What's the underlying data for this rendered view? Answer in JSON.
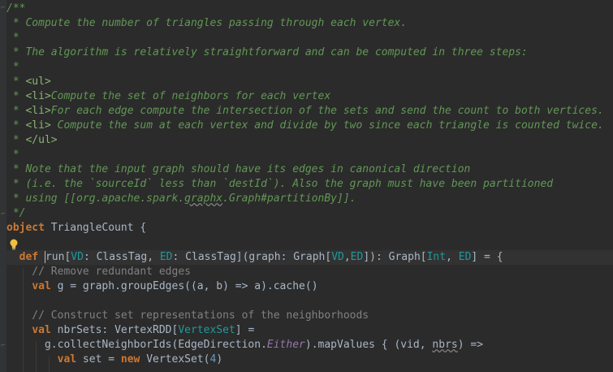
{
  "lines": [
    {
      "segments": [
        {
          "t": "/**",
          "c": "doc"
        }
      ]
    },
    {
      "segments": [
        {
          "t": " * Compute the number of triangles passing through each vertex.",
          "c": "doc"
        }
      ]
    },
    {
      "segments": [
        {
          "t": " *",
          "c": "doc"
        }
      ]
    },
    {
      "segments": [
        {
          "t": " * The algorithm is relatively straightforward and can be computed in three steps:",
          "c": "doc"
        }
      ]
    },
    {
      "segments": [
        {
          "t": " *",
          "c": "doc"
        }
      ]
    },
    {
      "segments": [
        {
          "t": " * ",
          "c": "doc"
        },
        {
          "t": "<ul>",
          "c": "doc doc-tag"
        }
      ]
    },
    {
      "segments": [
        {
          "t": " * ",
          "c": "doc"
        },
        {
          "t": "<li>",
          "c": "doc doc-tag"
        },
        {
          "t": "Compute the set of neighbors for each vertex",
          "c": "doc"
        }
      ]
    },
    {
      "segments": [
        {
          "t": " * ",
          "c": "doc"
        },
        {
          "t": "<li>",
          "c": "doc doc-tag"
        },
        {
          "t": "For each edge compute the intersection of the sets and send the count to both vertices.",
          "c": "doc"
        }
      ]
    },
    {
      "segments": [
        {
          "t": " * ",
          "c": "doc"
        },
        {
          "t": "<li>",
          "c": "doc doc-tag"
        },
        {
          "t": " Compute the sum at each vertex and divide by two since each triangle is counted twice.",
          "c": "doc"
        }
      ]
    },
    {
      "segments": [
        {
          "t": " * ",
          "c": "doc"
        },
        {
          "t": "</ul>",
          "c": "doc doc-tag"
        }
      ]
    },
    {
      "segments": [
        {
          "t": " *",
          "c": "doc"
        }
      ]
    },
    {
      "segments": [
        {
          "t": " * Note that the input graph should have its edges in canonical direction",
          "c": "doc"
        }
      ]
    },
    {
      "segments": [
        {
          "t": " * (i.e. the `sourceId` less than `destId`). Also the graph must have been partitioned",
          "c": "doc"
        }
      ]
    },
    {
      "segments": [
        {
          "t": " * using [[org.apache.spark.",
          "c": "doc"
        },
        {
          "t": "graphx",
          "c": "doc squiggle"
        },
        {
          "t": ".Graph#partitionBy]].",
          "c": "doc"
        }
      ]
    },
    {
      "segments": [
        {
          "t": " */",
          "c": "doc"
        }
      ]
    },
    {
      "segments": [
        {
          "t": "object",
          "c": "kw"
        },
        {
          "t": " TriangleCount {",
          "c": "type"
        }
      ]
    },
    {
      "segments": [
        {
          "t": "",
          "c": "type"
        }
      ]
    },
    {
      "current": true,
      "segments": [
        {
          "t": "  ",
          "c": "type"
        },
        {
          "t": "def",
          "c": "kw"
        },
        {
          "t": " ",
          "c": "type"
        },
        {
          "t": "run",
          "c": "type caret"
        },
        {
          "t": "[",
          "c": "type"
        },
        {
          "t": "VD",
          "c": "tparam"
        },
        {
          "t": ": ClassTag, ",
          "c": "type"
        },
        {
          "t": "ED",
          "c": "tparam"
        },
        {
          "t": ": ClassTag](graph: Graph[",
          "c": "type"
        },
        {
          "t": "VD",
          "c": "tparam"
        },
        {
          "t": ",",
          "c": "type"
        },
        {
          "t": "ED",
          "c": "tparam"
        },
        {
          "t": "]): Graph[",
          "c": "type"
        },
        {
          "t": "Int",
          "c": "tparam"
        },
        {
          "t": ", ",
          "c": "type"
        },
        {
          "t": "ED",
          "c": "tparam"
        },
        {
          "t": "] = {",
          "c": "type"
        }
      ]
    },
    {
      "segments": [
        {
          "t": "    // Remove redundant edges",
          "c": "cmt"
        }
      ]
    },
    {
      "segments": [
        {
          "t": "    ",
          "c": "type"
        },
        {
          "t": "val",
          "c": "kw"
        },
        {
          "t": " g = graph.groupEdges((a, b) => a).cache()",
          "c": "type"
        }
      ]
    },
    {
      "segments": [
        {
          "t": "",
          "c": "type"
        }
      ]
    },
    {
      "segments": [
        {
          "t": "    // Construct set representations of the neighborhoods",
          "c": "cmt"
        }
      ]
    },
    {
      "segments": [
        {
          "t": "    ",
          "c": "type"
        },
        {
          "t": "val",
          "c": "kw"
        },
        {
          "t": " nbrSets: VertexRDD[",
          "c": "type"
        },
        {
          "t": "VertexSet",
          "c": "tparam"
        },
        {
          "t": "] =",
          "c": "type"
        }
      ]
    },
    {
      "segments": [
        {
          "t": "      g.collectNeighborIds(EdgeDirection.",
          "c": "type"
        },
        {
          "t": "Either",
          "c": "italic-field"
        },
        {
          "t": ").mapValues { (vid, ",
          "c": "type"
        },
        {
          "t": "nbrs",
          "c": "type squiggle"
        },
        {
          "t": ") =>",
          "c": "type"
        }
      ]
    },
    {
      "segments": [
        {
          "t": "        ",
          "c": "type"
        },
        {
          "t": "val",
          "c": "kw"
        },
        {
          "t": " set = ",
          "c": "type"
        },
        {
          "t": "new",
          "c": "kw"
        },
        {
          "t": " VertexSet(",
          "c": "type"
        },
        {
          "t": "4",
          "c": "num"
        },
        {
          "t": ")",
          "c": "type"
        }
      ]
    }
  ],
  "icons": {
    "lightbulb": "lightbulb-icon",
    "fold": "fold-marker-icon"
  }
}
